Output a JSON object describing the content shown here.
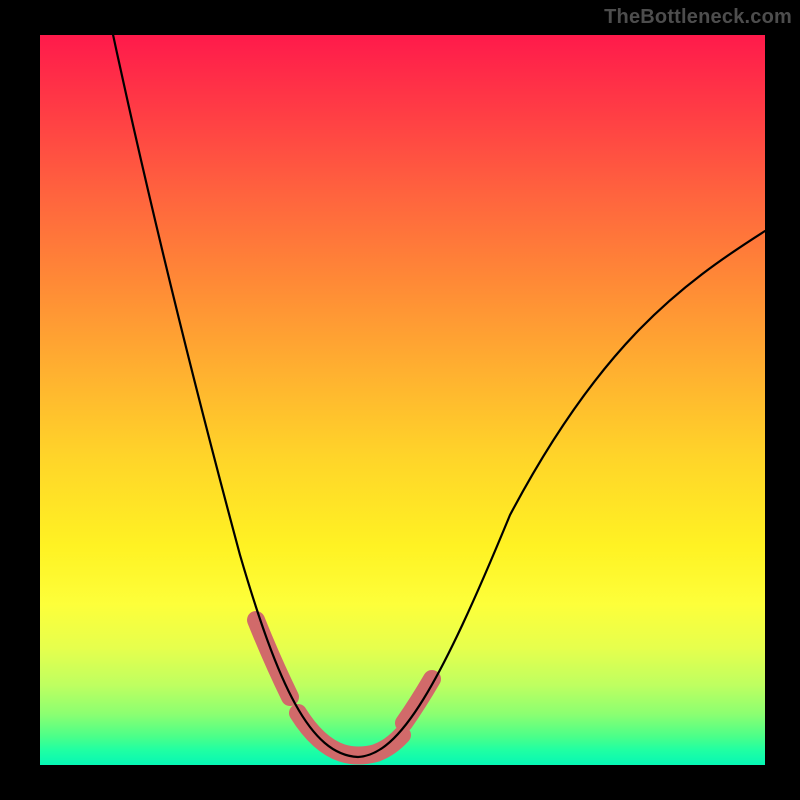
{
  "attribution": "TheBottleneck.com",
  "colors": {
    "frame": "#000000",
    "curve": "#000000",
    "highlight": "#d16a6a",
    "gradient_top": "#ff1a4b",
    "gradient_bottom": "#06f7b5"
  },
  "chart_data": {
    "type": "line",
    "title": "",
    "xlabel": "",
    "ylabel": "",
    "xlim": [
      0,
      100
    ],
    "ylim": [
      0,
      100
    ],
    "grid": false,
    "legend": false,
    "x": [
      0,
      4,
      8,
      12,
      16,
      20,
      24,
      28,
      32,
      34,
      36,
      38,
      40,
      42,
      44,
      48,
      52,
      56,
      60,
      64,
      68,
      72,
      76,
      80,
      84,
      88,
      92,
      96,
      100
    ],
    "series": [
      {
        "name": "bottleneck-curve",
        "values": [
          118,
          100,
          84,
          70,
          57,
          46,
          36,
          27,
          18,
          14,
          10,
          6,
          3,
          1.5,
          1,
          1.5,
          4,
          9,
          14,
          20,
          26,
          32,
          38,
          45,
          51,
          57,
          63,
          68,
          73
        ]
      }
    ],
    "highlight_segments": [
      {
        "x_range": [
          30,
          34
        ],
        "note": "left-descent-dots"
      },
      {
        "x_range": [
          36,
          48
        ],
        "note": "valley-floor"
      },
      {
        "x_range": [
          49,
          53
        ],
        "note": "right-ascent-dots"
      }
    ]
  }
}
